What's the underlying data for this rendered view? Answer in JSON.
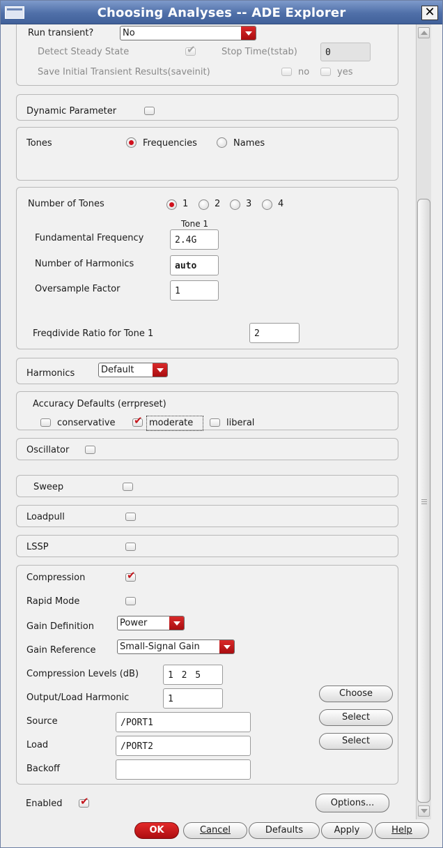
{
  "window": {
    "title": "Choosing Analyses -- ADE Explorer",
    "close_glyph": "✕"
  },
  "transient": {
    "label": "Run transient?",
    "value": "No",
    "detect_steady_label": "Detect Steady State",
    "stop_time_label": "Stop Time(tstab)",
    "stop_time_value": "0",
    "save_initial_label": "Save Initial Transient Results(saveinit)",
    "no_label": "no",
    "yes_label": "yes"
  },
  "dynamic_parameter": {
    "label": "Dynamic Parameter"
  },
  "tones": {
    "label": "Tones",
    "frequencies_label": "Frequencies",
    "names_label": "Names",
    "selected": "Frequencies"
  },
  "number_of_tones": {
    "label": "Number of Tones",
    "options": [
      "1",
      "2",
      "3",
      "4"
    ],
    "selected": "1",
    "column_header": "Tone 1",
    "fundamental_label": "Fundamental Frequency",
    "fundamental_value": "2.4G",
    "harmonics_label": "Number of Harmonics",
    "harmonics_value": "auto",
    "oversample_label": "Oversample Factor",
    "oversample_value": "1",
    "freqdivide_label": "Freqdivide Ratio for Tone 1",
    "freqdivide_value": "2"
  },
  "harmonics": {
    "label": "Harmonics",
    "value": "Default"
  },
  "accuracy": {
    "label": "Accuracy Defaults (errpreset)",
    "conservative_label": "conservative",
    "moderate_label": "moderate",
    "liberal_label": "liberal",
    "selected": "moderate"
  },
  "oscillator": {
    "label": "Oscillator"
  },
  "sweep": {
    "label": "Sweep"
  },
  "loadpull": {
    "label": "Loadpull"
  },
  "lssp": {
    "label": "LSSP"
  },
  "compression": {
    "label": "Compression",
    "rapid_mode_label": "Rapid Mode",
    "gain_definition_label": "Gain Definition",
    "gain_definition_value": "Power",
    "gain_reference_label": "Gain Reference",
    "gain_reference_value": "Small-Signal Gain",
    "levels_label": "Compression Levels (dB)",
    "levels_value": "1 2 5",
    "output_harmonic_label": "Output/Load Harmonic",
    "output_harmonic_value": "1",
    "choose_label": "Choose",
    "source_label": "Source",
    "source_value": "/PORT1",
    "select_source_label": "Select",
    "load_label": "Load",
    "load_value": "/PORT2",
    "select_load_label": "Select",
    "backoff_label": "Backoff",
    "backoff_value": ""
  },
  "footer": {
    "enabled_label": "Enabled",
    "options_label": "Options...",
    "ok_label": "OK",
    "cancel_label": "Cancel",
    "defaults_label": "Defaults",
    "apply_label": "Apply",
    "help_label": "Help"
  },
  "colors": {
    "accent_red": "#c4161c",
    "title_blue": "#4f6fa8"
  }
}
